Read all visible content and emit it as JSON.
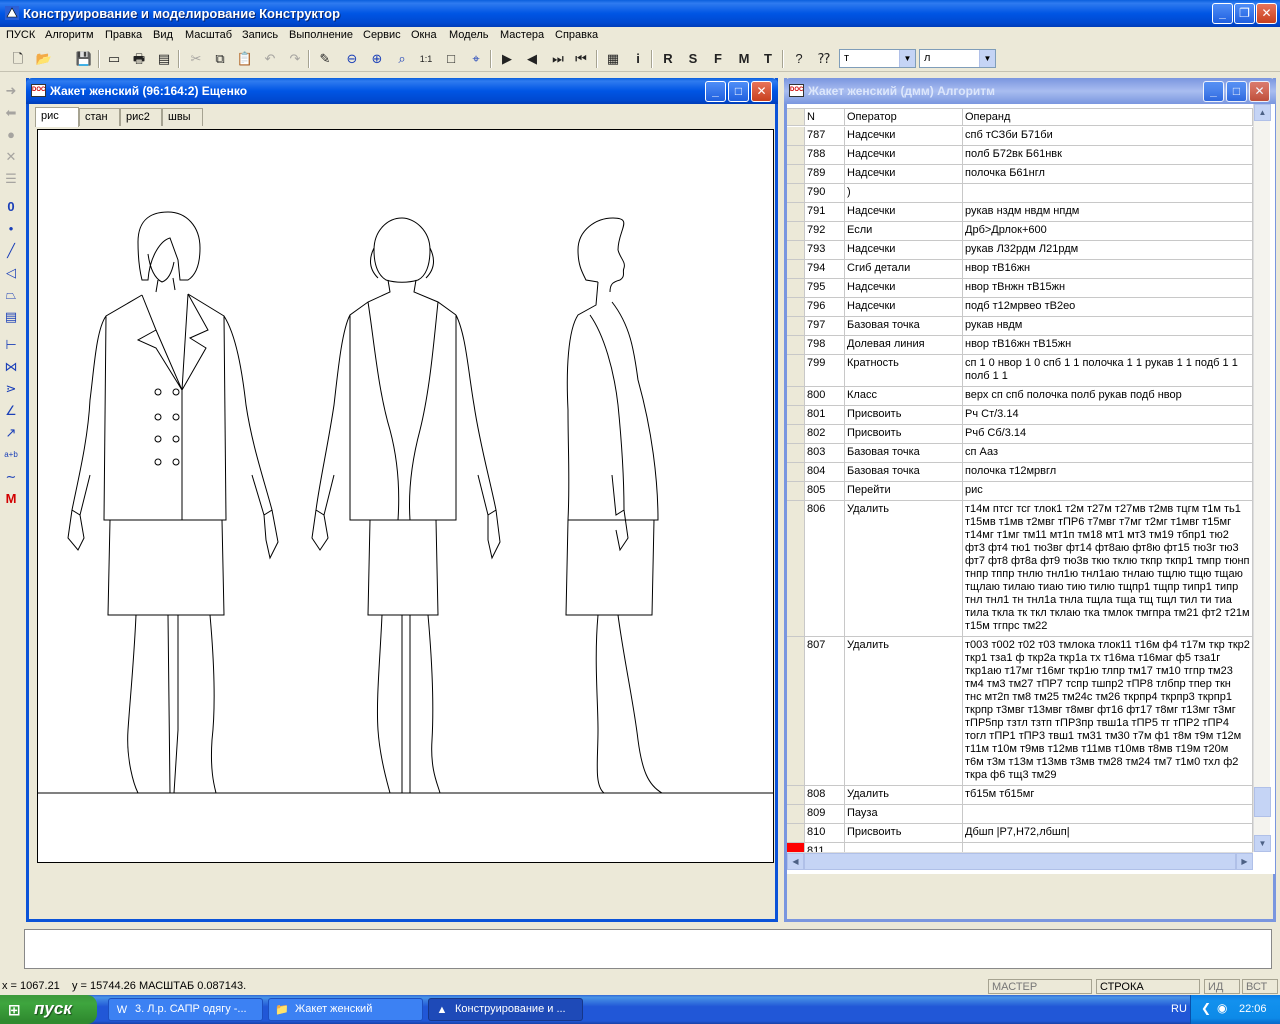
{
  "app": {
    "title": "Конструирование и моделирование  Конструктор"
  },
  "menu": [
    "ПУСК",
    "Алгоритм",
    "Правка",
    "Вид",
    "Масштаб",
    "Запись",
    "Выполнение",
    "Сервис",
    "Окна",
    "Модель",
    "Мастера",
    "Справка"
  ],
  "toolbar": {
    "letters": [
      "R",
      "S",
      "F",
      "M",
      "T"
    ],
    "info_label": "i",
    "combo1": "т",
    "combo2": "л"
  },
  "left_tools": {
    "zero_label": "0",
    "ab_label": "a+b",
    "m_label": "M"
  },
  "drawing_window": {
    "title": "Жакет женский (96:164:2) Ещенко",
    "tabs": [
      "рис",
      "стан",
      "рис2",
      "швы"
    ],
    "active_tab": "рис"
  },
  "algorithm_window": {
    "title": "Жакет женский (дмм) Алгоритм",
    "columns": [
      "N",
      "Оператор",
      "Операнд"
    ],
    "rows": [
      {
        "n": "787",
        "op": "Надсечки",
        "od": "спб тСЗби  Б71би"
      },
      {
        "n": "788",
        "op": "Надсечки",
        "od": "полб Б72вк  Б61нвк"
      },
      {
        "n": "789",
        "op": "Надсечки",
        "od": "полочка Б61нгл"
      },
      {
        "n": "790",
        "op": ")",
        "od": ""
      },
      {
        "n": "791",
        "op": "Надсечки",
        "od": "рукав нздм  нвдм  нпдм"
      },
      {
        "n": "792",
        "op": "Если",
        "od": "Дрб>Дрлок+600"
      },
      {
        "n": "793",
        "op": "Надсечки",
        "od": "рукав Л32рдм  Л21рдм"
      },
      {
        "n": "794",
        "op": "Сгиб детали",
        "od": "нвор тВ16жн"
      },
      {
        "n": "795",
        "op": "Надсечки",
        "od": "нвор  тВнжн тВ15жн"
      },
      {
        "n": "796",
        "op": "Надсечки",
        "od": "подб т12мрвео  тВ2ео"
      },
      {
        "n": "797",
        "op": "Базовая точка",
        "od": "рукав нвдм"
      },
      {
        "n": "798",
        "op": "Долевая линия",
        "od": "нвор тВ16жн тВ15жн"
      },
      {
        "n": "799",
        "op": "Кратность",
        "od": "сп 1 0 нвор 1 0 спб 1 1 полочка 1 1 рукав 1 1 подб 1 1 полб 1 1"
      },
      {
        "n": "800",
        "op": "Класс",
        "od": "верх сп спб полочка полб рукав подб нвор"
      },
      {
        "n": "801",
        "op": "Присвоить",
        "od": "Рч Ст/3.14"
      },
      {
        "n": "802",
        "op": "Присвоить",
        "od": "Рчб Сб/3.14"
      },
      {
        "n": "803",
        "op": "Базовая точка",
        "od": "сп Ааз"
      },
      {
        "n": "804",
        "op": "Базовая точка",
        "od": "полочка т12мрвгл"
      },
      {
        "n": "805",
        "op": "Перейти",
        "od": "рис"
      },
      {
        "n": "806",
        "op": "Удалить",
        "od": "т14м птсг тсг тлок1 т2м т27м т27мв т2мв тцгм т1м ть1 т15мв т1мв т2мвг тПР6 т7мвг т7мг т2мг т1мвг т15мг т14мг т1мг тм11 мт1п тм18 мт1 мт3 тм19 тбпр1 тю2 фт3 фт4 тю1 тю3вг фт14 фт8аю фт8ю фт15 тю3г тю3 фт7 фт8 фт8а фт9 тю3в ткю тклю ткпр ткпр1 тмпр тюнп тнпр тппр тнлю тнл1ю тнл1аю тнлаю тщлю тщю тщаю тщлаю тилаю тиаю тию тилю тщпр1 тщпр типр1 типр тнл тнл1 тн тнл1а тнла тщла тща тщ тщл тил ти тиа тила ткла тк ткл тклаю тка тмлок тмгпра тм21 фт2 т21м т15м тгпрс тм22"
      },
      {
        "n": "807",
        "op": "Удалить",
        "od": "т003 т002 т02 т03 тмлока тлок11 т16м ф4 т17м ткр ткр2 ткр1 тза1 ф ткр2а ткр1а тх т16ма т16маг ф5 тза1г ткр1аю т17мг т16мг ткр1ю тлпр тм17 тм10 тгпр тм23 тм4 тм3 тм27 тПР7 тспр тшпр2 тПР8 тлбпр тпер ткн тнс мт2п тм8 тм25 тм24с тм26 ткрпр4 ткрпр3 ткрпр1 ткрпр т3мвг т13мвг т8мвг фт16 фт17 т8мг т13мг т3мг тПР5пр тзтл тзтп тПР3пр твш1а тПР5 тг тПР2 тПР4 тогл тПР1 тПР3 твш1 тм31 тм30 т7м ф1 т8м т9м т12м т11м т10м т9мв т12мв т11мв т10мв т8мв т19м т20м т6м т3м т13м т13мв т3мв тм28 тм24 тм7 т1м0 тхл ф2 ткра ф6 тщ3 тм29"
      },
      {
        "n": "808",
        "op": "Удалить",
        "od": "тб15м тб15мг"
      },
      {
        "n": "809",
        "op": "Пауза",
        "od": ""
      },
      {
        "n": "810",
        "op": "Присвоить",
        "od": "Дбшп |Р7,Н72,лбшп|"
      },
      {
        "n": "811",
        "op": "",
        "od": ""
      }
    ]
  },
  "statusbar": {
    "x": "x = 1067.21",
    "y": "y = 15744.26 МАСШТАБ 0.087143.",
    "master": "МАСТЕР",
    "row": "СТРОКА",
    "id": "ИД",
    "vst": "ВСТ"
  },
  "taskbar": {
    "start": "пуск",
    "tasks": [
      "3. Л.р. САПР одягу -...",
      "Жакет женский",
      "Конструирование и ..."
    ],
    "lang": "RU",
    "clock": "22:06"
  },
  "colors": {
    "xp_blue": "#0055e4",
    "current_row_marker": "#ff0000"
  }
}
